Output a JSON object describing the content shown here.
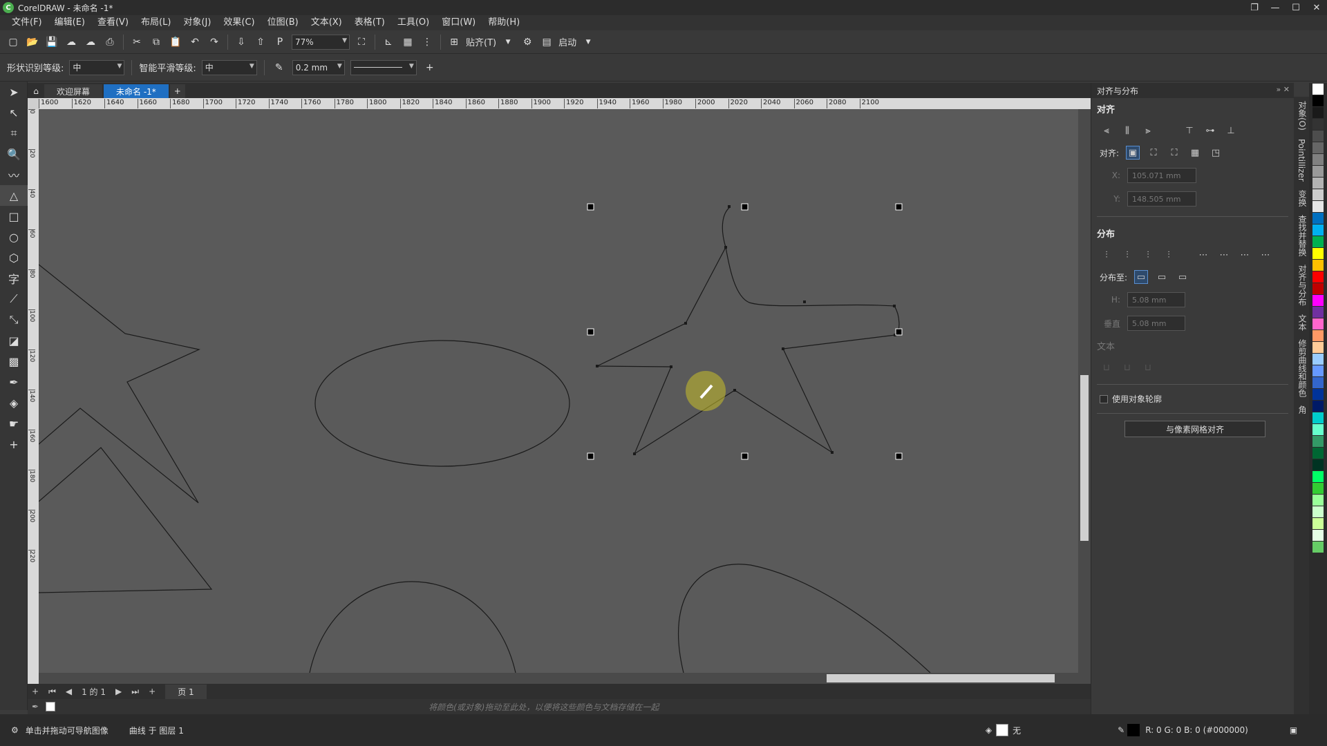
{
  "title": "CorelDRAW - 未命名 -1*",
  "menu": [
    "文件(F)",
    "编辑(E)",
    "查看(V)",
    "布局(L)",
    "对象(J)",
    "效果(C)",
    "位图(B)",
    "文本(X)",
    "表格(T)",
    "工具(O)",
    "窗口(W)",
    "帮助(H)"
  ],
  "toolbar": {
    "zoom": "77%",
    "snap_label": "贴齐(T)",
    "launch_label": "启动"
  },
  "propbar": {
    "shape_label": "形状识别等级:",
    "shape_value": "中",
    "smooth_label": "智能平滑等级:",
    "smooth_value": "中",
    "outline_width": "0.2 mm"
  },
  "tabs": {
    "welcome": "欢迎屏幕",
    "doc": "未命名 -1*"
  },
  "ruler_ticks": [
    "1600",
    "1620",
    "1640",
    "1660",
    "1680",
    "1700",
    "1720",
    "1740",
    "1760",
    "1780",
    "1800",
    "1820",
    "1840",
    "1860",
    "1880",
    "1900",
    "1920",
    "1940",
    "1960",
    "1980",
    "2000",
    "2020",
    "2040",
    "2060",
    "2080",
    "2100"
  ],
  "vruler_ticks": [
    "0",
    "20",
    "40",
    "60",
    "80",
    "100",
    "120",
    "140",
    "160",
    "180",
    "200",
    "220"
  ],
  "docker": {
    "title": "对齐与分布",
    "align_title": "对齐",
    "align_to_label": "对齐:",
    "x_label": "X:",
    "x_value": "105.071 mm",
    "y_label": "Y:",
    "y_value": "148.505 mm",
    "distribute_title": "分布",
    "distribute_to_label": "分布至:",
    "h_label": "H:",
    "h_value": "5.08 mm",
    "v_label": "垂直",
    "v_value": "5.08 mm",
    "text_title": "文本",
    "use_outline_label": "使用对象轮廓",
    "pixel_grid_button": "与像素网格对齐"
  },
  "docker_tabs": [
    "对象(O)",
    "Pointillizer",
    "变换",
    "查找并替换",
    "对齐与分布",
    "文本",
    "修剪曲线和颜色",
    "角"
  ],
  "pagenav": {
    "page_count": "1 的 1",
    "page_tab": "页 1"
  },
  "colorbar_hint": "将颜色(或对象)拖动至此处，以便将这些颜色与文档存储在一起",
  "status": {
    "hint": "单击并拖动可导航图像",
    "object_info": "曲线 于 图层 1",
    "fill_label": "无",
    "color_info": "R: 0 G: 0 B: 0 (#000000)"
  },
  "palette_colors": [
    "#ffffff",
    "#000000",
    "#1a1a1a",
    "#333333",
    "#4d4d4d",
    "#666666",
    "#808080",
    "#999999",
    "#b3b3b3",
    "#cccccc",
    "#e6e6e6",
    "#0070c0",
    "#00b0f0",
    "#00b050",
    "#ffff00",
    "#ffc000",
    "#ff0000",
    "#c00000",
    "#ff00ff",
    "#7030a0",
    "#ff66cc",
    "#ff9966",
    "#ffcc99",
    "#99ccff",
    "#6699ff",
    "#3366cc",
    "#003399",
    "#001a66",
    "#00cccc",
    "#66ffcc",
    "#339966",
    "#006633",
    "#003322",
    "#00ff66",
    "#33cc33",
    "#99ff99",
    "#ccffcc",
    "#ccff99",
    "#e6ffe6",
    "#66cc66"
  ]
}
